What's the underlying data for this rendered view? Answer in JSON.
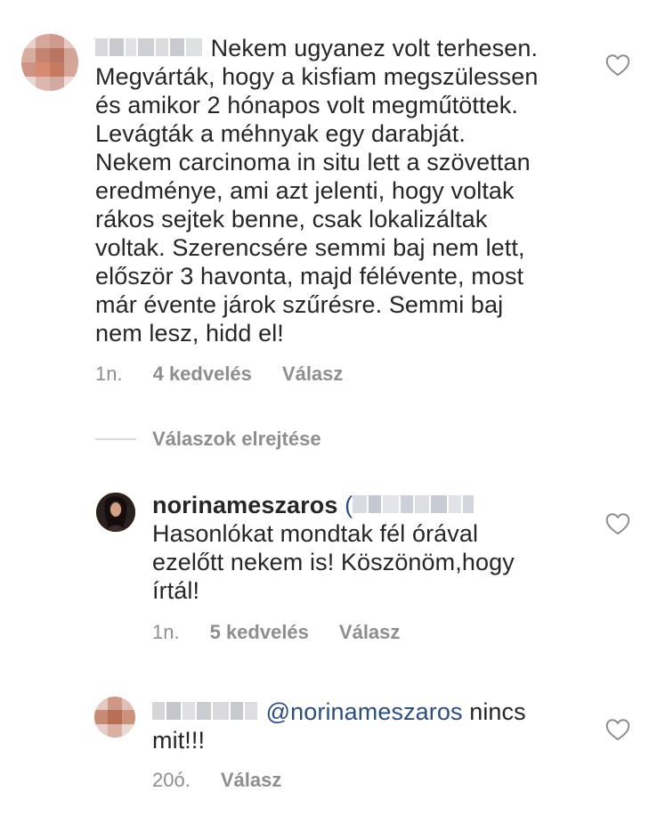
{
  "comments": [
    {
      "text": "Nekem ugyanez volt terhesen. Megvárták, hogy a kisfiam megszülessen és amikor 2 hónapos volt megműtöttek. Levágták a méhnyak egy darabját. Nekem carcinoma in situ lett a szövettan eredménye, ami azt jelenti, hogy voltak rákos sejtek benne, csak lokalizáltak voltak. Szerencsére semmi baj nem lett, először 3 havonta, majd félévente, most már évente járok szűrésre. Semmi baj nem lesz, hidd el!",
      "lines": [
        "Nekem ugyanez volt terhesen.",
        "Megvárták, hogy a kisfiam megszülessen",
        "és amikor 2 hónapos volt megműtöttek.",
        "Levágták a méhnyak egy darabját.",
        "Nekem carcinoma in situ lett a szövettan",
        "eredménye, ami azt jelenti, hogy voltak",
        "rákos sejtek benne, csak lokalizáltak",
        "voltak. Szerencsére semmi baj nem lett,",
        "először 3 havonta, majd félévente, most",
        "már évente járok szűrésre. Semmi baj",
        "nem lesz, hidd el!"
      ],
      "time": "1n.",
      "likes": "4 kedvelés",
      "reply": "Válasz"
    }
  ],
  "hide_replies": "Válaszok elrejtése",
  "replies": [
    {
      "username": "norinameszaros",
      "mention_open": "(",
      "lines": [
        "Hasonlókat mondtak fél órával",
        "ezelőtt nekem is! Köszönöm,hogy",
        "írtál!"
      ],
      "time": "1n.",
      "likes": "5 kedvelés",
      "reply": "Válasz"
    },
    {
      "mention": "@norinameszaros",
      "line1_rest": " nincs",
      "line2": "mit!!!",
      "time": "20ó.",
      "reply": "Válasz"
    }
  ],
  "icons": {
    "like": "heart-outline-icon"
  },
  "colors": {
    "text": "#262626",
    "meta": "#8e8e8e",
    "mention": "#2b4e7e",
    "divider": "#dbdbdb"
  }
}
